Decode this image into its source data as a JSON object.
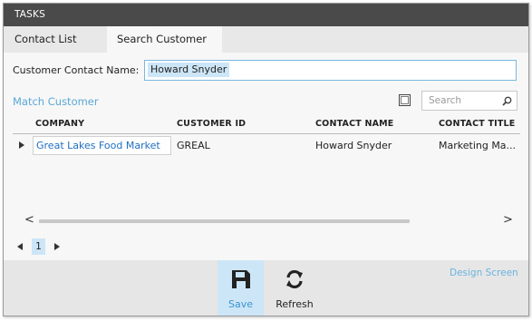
{
  "window": {
    "title": "TASKS"
  },
  "tabs": [
    {
      "label": "Contact List",
      "active": false
    },
    {
      "label": "Search Customer",
      "active": true
    }
  ],
  "form": {
    "customer_contact_label": "Customer Contact Name:",
    "customer_contact_value": "Howard Snyder"
  },
  "group": {
    "title": "Match Customer",
    "clear_label": "X",
    "search_placeholder": "Search"
  },
  "grid": {
    "columns": [
      "COMPANY",
      "CUSTOMER ID",
      "CONTACT NAME",
      "CONTACT TITLE"
    ],
    "rows": [
      {
        "company": "Great Lakes Food Market",
        "customer_id": "GREAL",
        "contact_name": "Howard Snyder",
        "contact_title": "Marketing Ma..."
      }
    ]
  },
  "scroll": {
    "left": "<",
    "right": ">"
  },
  "pager": {
    "current_page": "1"
  },
  "commands": {
    "save_label": "Save",
    "refresh_label": "Refresh",
    "design_screen_label": "Design Screen"
  },
  "colors": {
    "titlebar": "#4a4a4a",
    "accent": "#3a95cf",
    "selection": "#cde6f7",
    "link": "#1e6fc0"
  },
  "icons": [
    "search-icon",
    "clear-icon",
    "row-indicator-icon",
    "save-icon",
    "refresh-icon",
    "prev-page-icon",
    "next-page-icon"
  ]
}
